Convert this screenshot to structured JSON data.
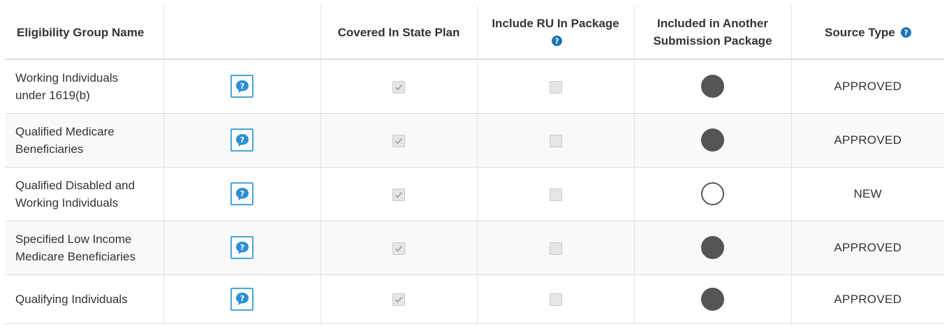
{
  "table": {
    "headers": {
      "name": "Eligibility Group Name",
      "help": "",
      "covered": "Covered In State Plan",
      "include_ru": "Include RU In Package",
      "included_other_line1": "Included in Another",
      "included_other_line2": "Submission Package",
      "source_type": "Source Type"
    },
    "rows": [
      {
        "name_line1": "Working Individuals",
        "name_line2": "under 1619(b)",
        "covered": true,
        "include_ru": false,
        "included_other": true,
        "source_type": "APPROVED"
      },
      {
        "name_line1": "Qualified Medicare",
        "name_line2": "Beneficiaries",
        "covered": true,
        "include_ru": false,
        "included_other": true,
        "source_type": "APPROVED"
      },
      {
        "name_line1": "Qualified Disabled and",
        "name_line2": "Working Individuals",
        "covered": true,
        "include_ru": false,
        "included_other": false,
        "source_type": "NEW"
      },
      {
        "name_line1": "Specified Low Income",
        "name_line2": "Medicare Beneficiaries",
        "covered": true,
        "include_ru": false,
        "included_other": true,
        "source_type": "APPROVED"
      },
      {
        "name_line1": "Qualifying Individuals",
        "name_line2": "",
        "covered": true,
        "include_ru": false,
        "included_other": true,
        "source_type": "APPROVED"
      }
    ]
  },
  "icons": {
    "help_button": "speech-bubble-question-icon",
    "header_help": "question-circle-icon",
    "checkbox": "checkmark-icon"
  },
  "colors": {
    "help_blue": "#1a73b8",
    "help_border": "#4aa3d8",
    "radio_fill": "#555555",
    "checkbox_bg": "#e6e6e6"
  }
}
